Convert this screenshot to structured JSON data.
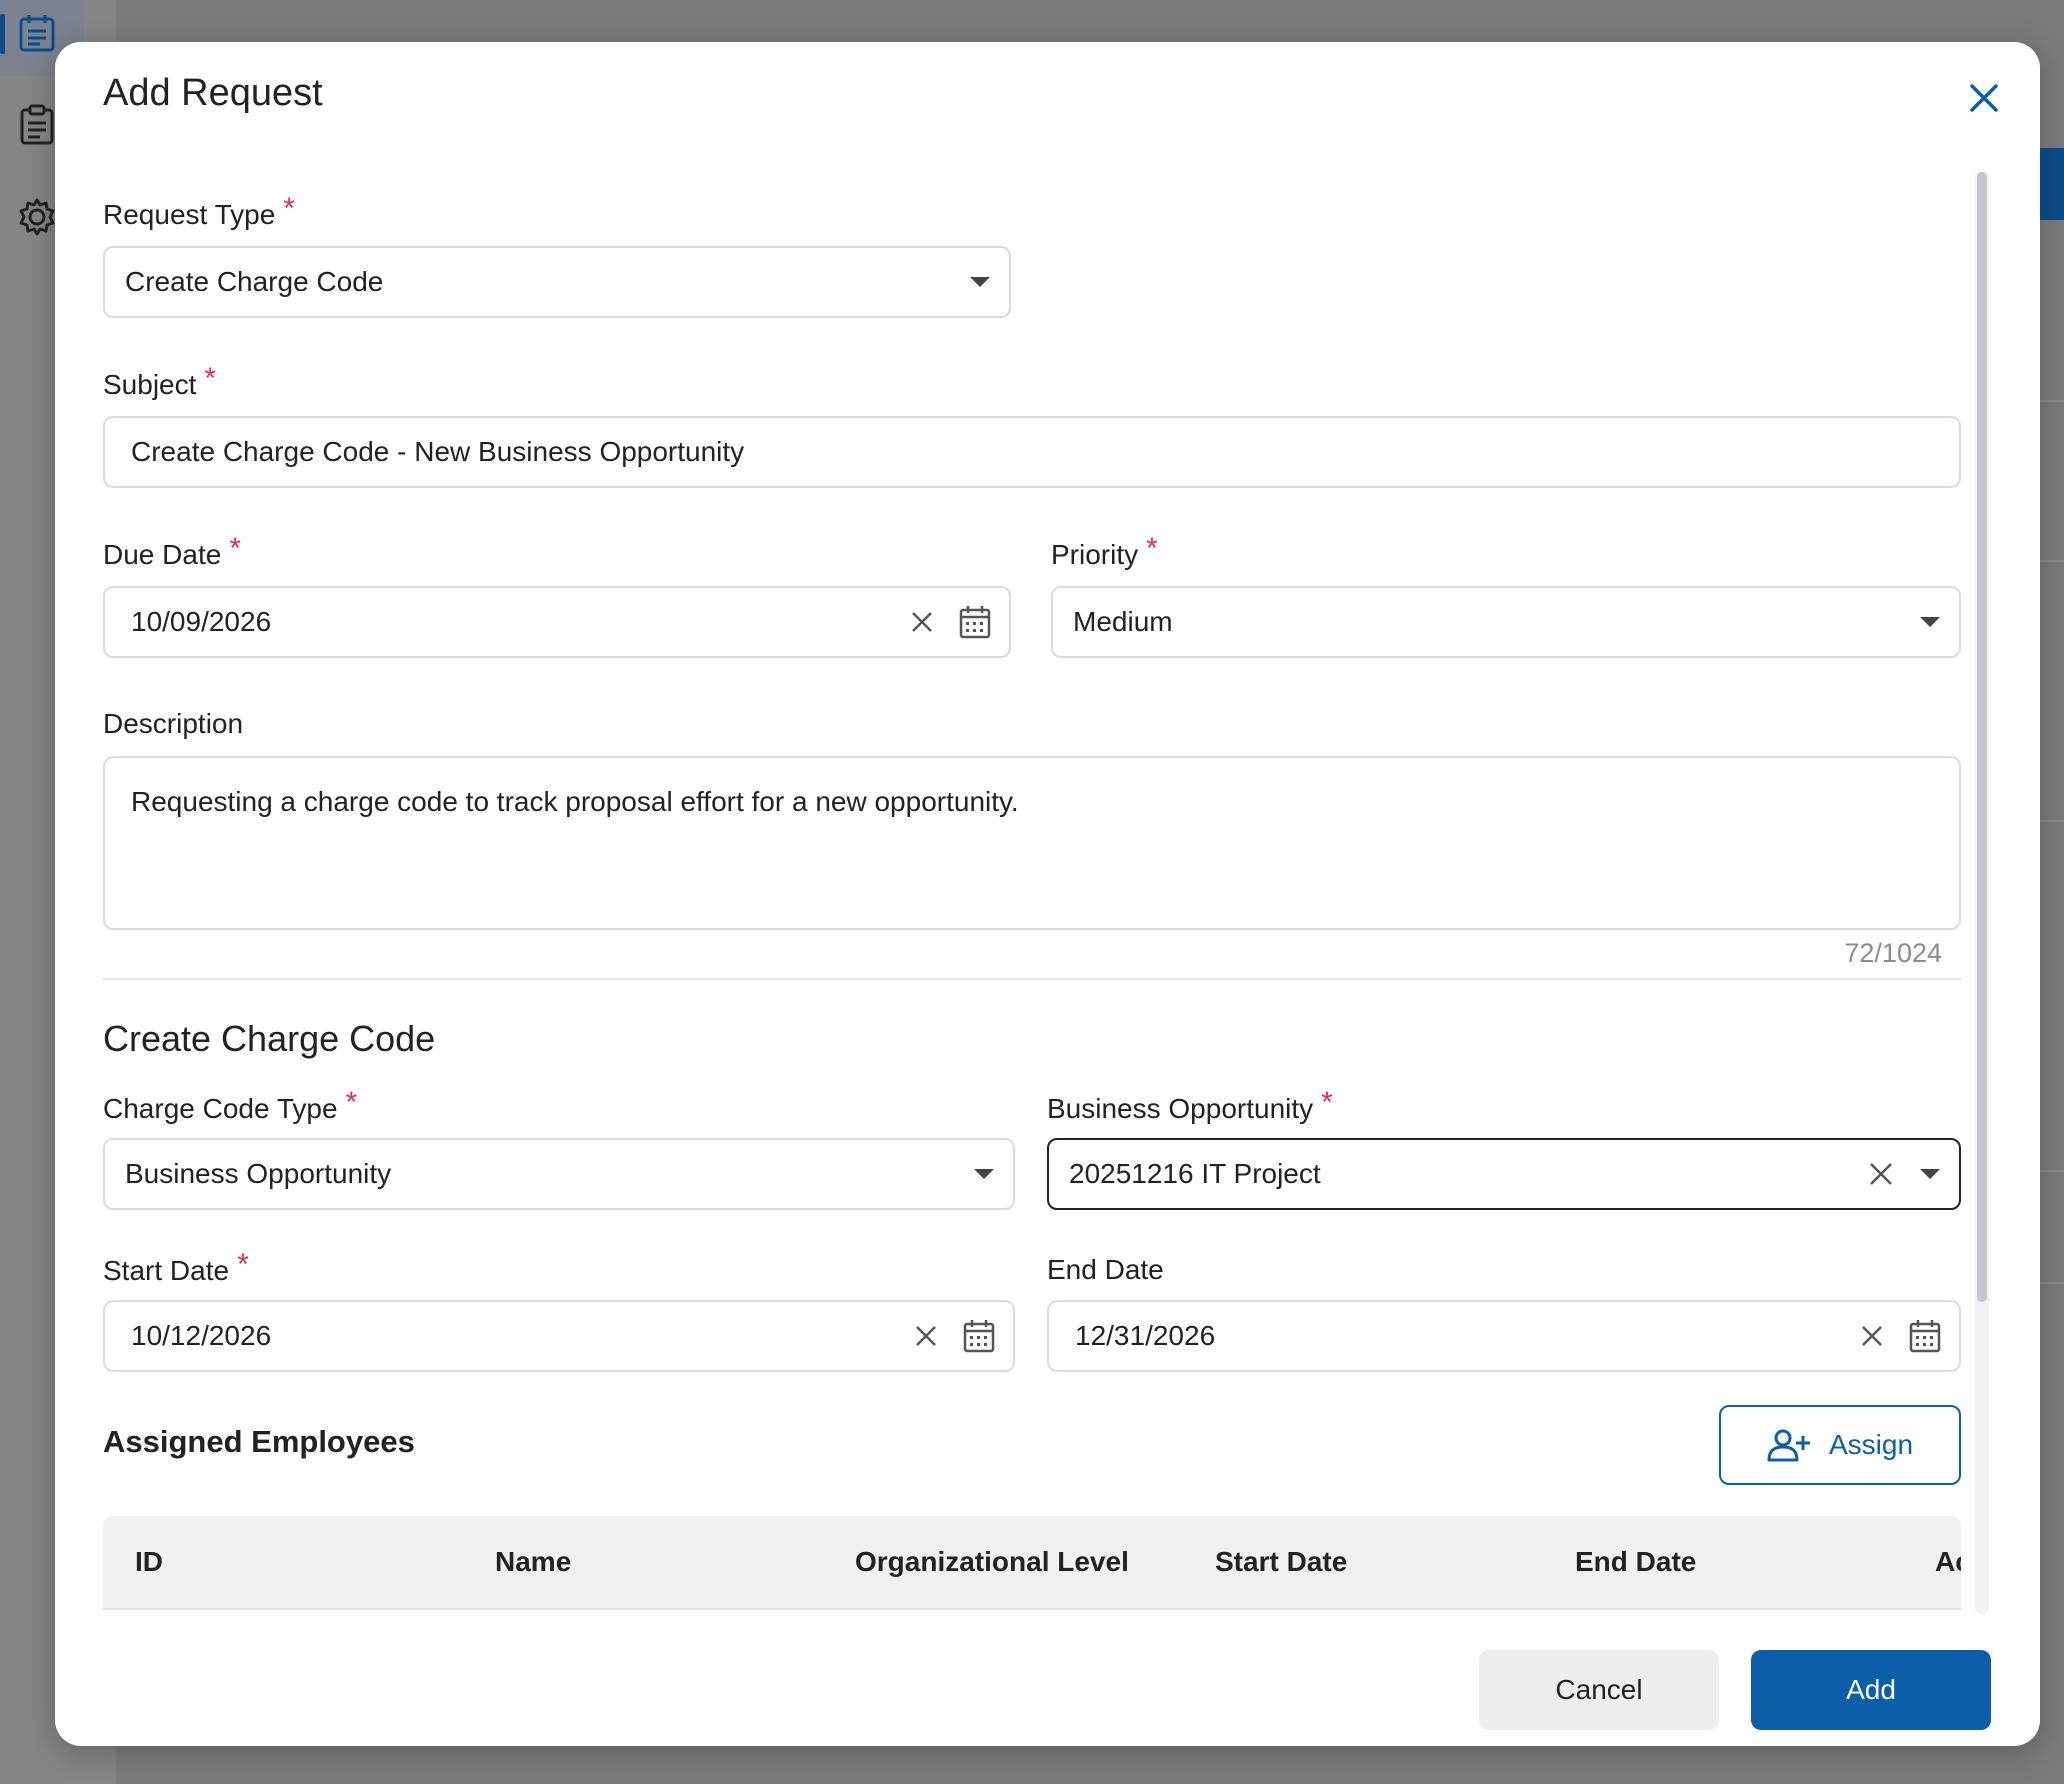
{
  "modal": {
    "title": "Add Request"
  },
  "request_type": {
    "label": "Request Type",
    "value": "Create Charge Code"
  },
  "subject": {
    "label": "Subject",
    "value": "Create Charge Code - New Business Opportunity"
  },
  "due_date": {
    "label": "Due Date",
    "value": "10/09/2026"
  },
  "priority": {
    "label": "Priority",
    "value": "Medium"
  },
  "description": {
    "label": "Description",
    "value": "Requesting a charge code to track proposal effort for a new opportunity.",
    "counter": "72/1024"
  },
  "charge_code_section": {
    "title": "Create Charge Code",
    "charge_code_type": {
      "label": "Charge Code Type",
      "value": "Business Opportunity"
    },
    "business_opportunity": {
      "label": "Business Opportunity",
      "value": "20251216 IT Project"
    },
    "start_date": {
      "label": "Start Date",
      "value": "10/12/2026"
    },
    "end_date": {
      "label": "End Date",
      "value": "12/31/2026"
    }
  },
  "assigned_employees": {
    "title": "Assigned Employees",
    "assign_label": "Assign",
    "columns": [
      "ID",
      "Name",
      "Organizational Level",
      "Start Date",
      "End Date",
      "Ac"
    ]
  },
  "footer": {
    "cancel_label": "Cancel",
    "add_label": "Add"
  },
  "colors": {
    "primary": "#0d5ea8",
    "required": "#e0304e"
  }
}
